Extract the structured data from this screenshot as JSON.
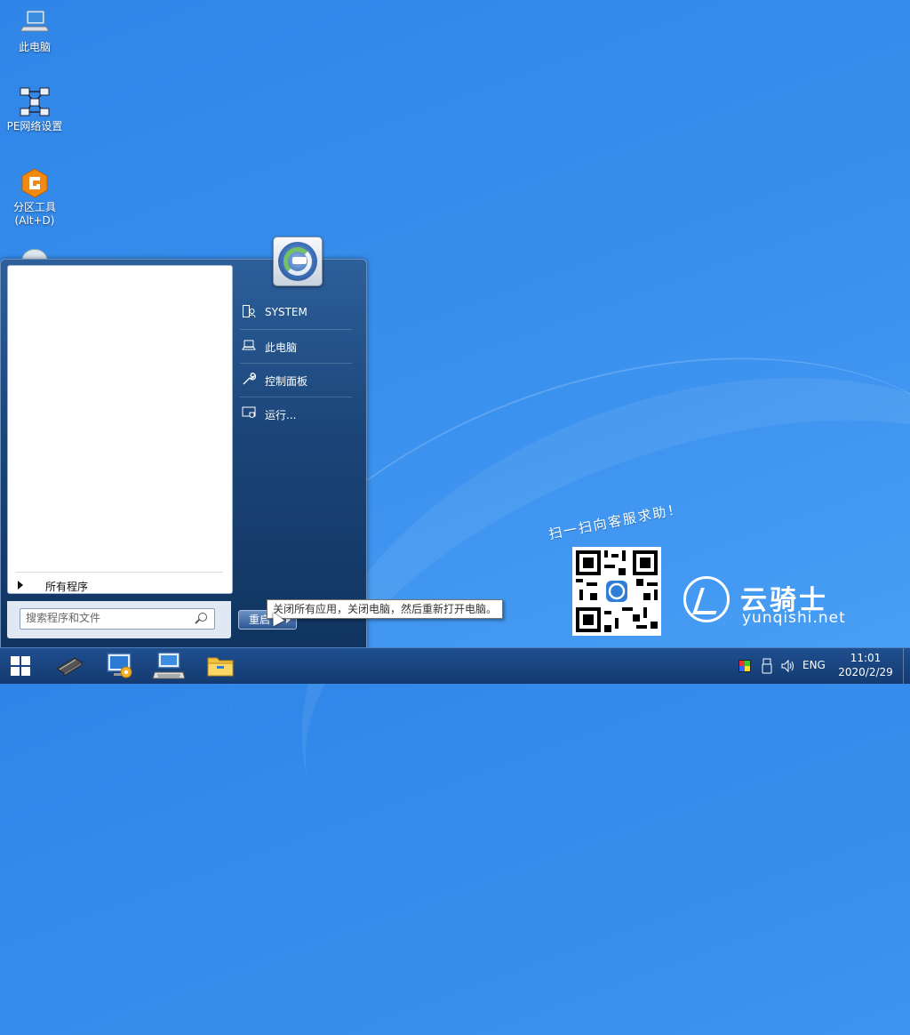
{
  "desktop": {
    "icons": [
      {
        "label": "此电脑",
        "icon": "computer-icon"
      },
      {
        "label": "PE网络设置",
        "icon": "network-icon"
      },
      {
        "label": "分区工具",
        "label2": "(Alt+D)",
        "icon": "diskgenius-icon"
      }
    ]
  },
  "start_menu": {
    "all_programs": "所有程序",
    "search_placeholder": "搜索程序和文件",
    "right_items": [
      {
        "label": "SYSTEM",
        "icon": "user-folder-icon"
      },
      {
        "label": "此电脑",
        "icon": "laptop-icon"
      },
      {
        "label": "控制面板",
        "icon": "wrench-icon"
      },
      {
        "label": "运行...",
        "icon": "run-icon"
      }
    ],
    "restart_label": "重启",
    "restart_tooltip": "关闭所有应用，关闭电脑，然后重新打开电脑。"
  },
  "branding": {
    "scan_text": "扫一扫向客服求助！",
    "name": "云骑士",
    "url": "yunqishi.net"
  },
  "taskbar": {
    "apps": [
      "chip-icon",
      "monitor-tool-icon",
      "keyboard-icon",
      "file-explorer-icon"
    ],
    "tray": {
      "language": "ENG",
      "time": "11:01",
      "date": "2020/2/29"
    }
  },
  "colors": {
    "desktop": "#3a90ee",
    "taskbar": "#1a4580",
    "start_menu": "#1b4579"
  }
}
